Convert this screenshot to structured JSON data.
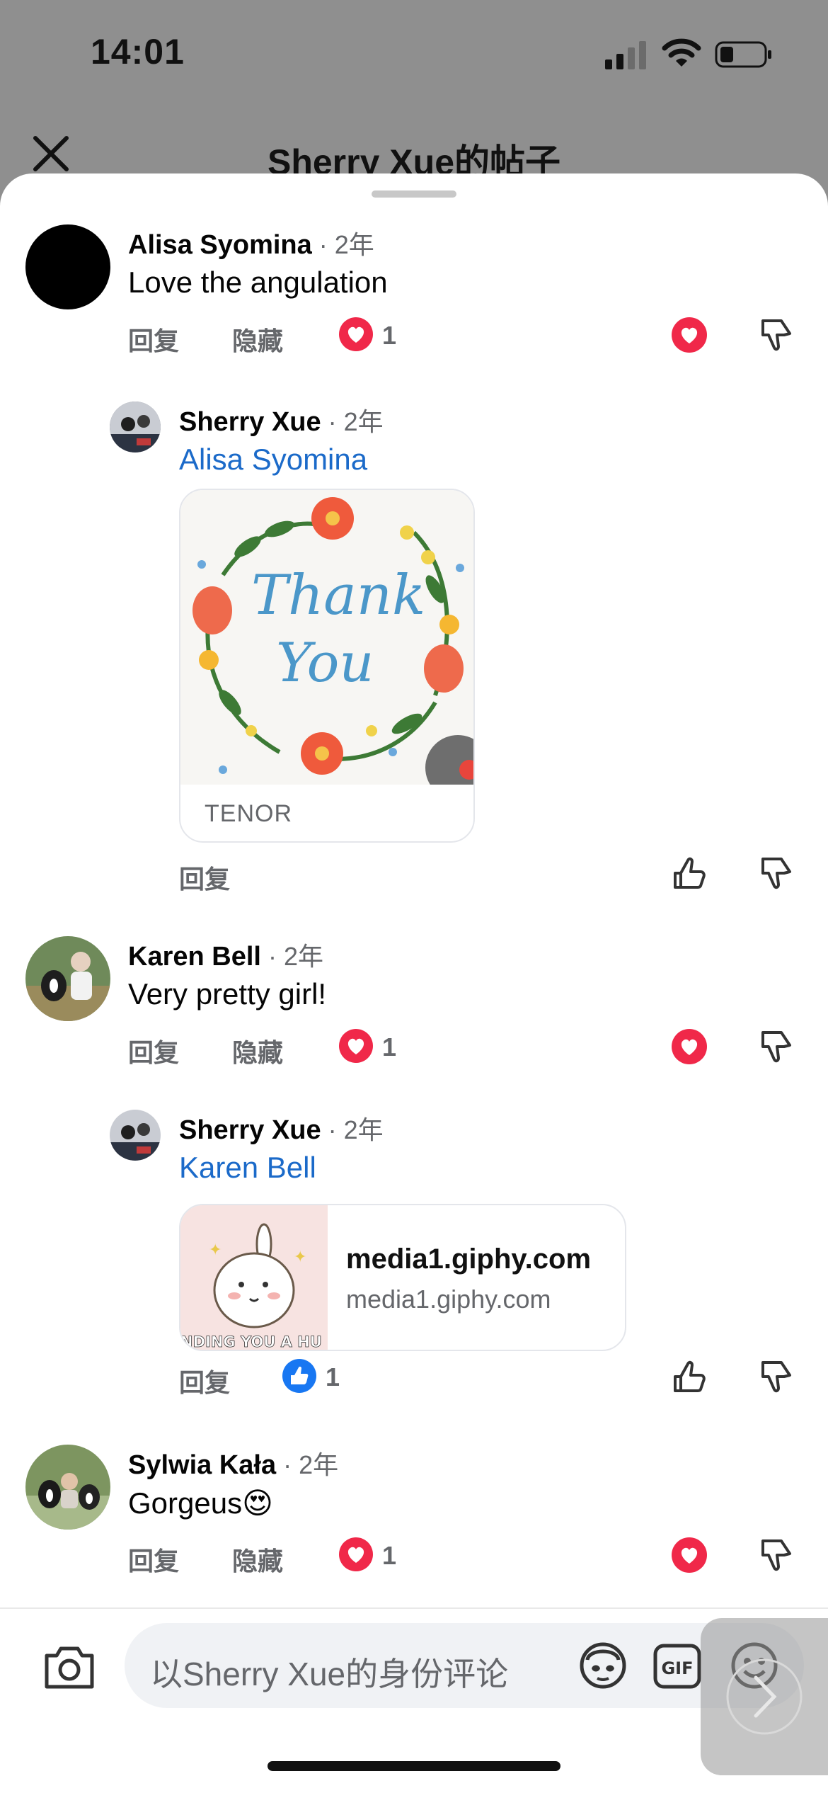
{
  "status_bar": {
    "time": "14:01"
  },
  "header": {
    "title": "Sherry Xue的帖子"
  },
  "actions": {
    "reply": "回复",
    "hide": "隐藏"
  },
  "comments": [
    {
      "author": "Alisa Syomina",
      "dot": "·",
      "time": "2年",
      "text": "Love the angulation",
      "reaction_count": "1",
      "reaction": "heart"
    },
    {
      "author": "Sherry Xue",
      "dot": "·",
      "time": "2年",
      "mention": "Alisa Syomina",
      "attachment": {
        "type": "gif",
        "source": "TENOR",
        "image_text": [
          "Thank",
          "You"
        ]
      }
    },
    {
      "author": "Karen Bell",
      "dot": "·",
      "time": "2年",
      "text": "Very pretty girl!",
      "reaction_count": "1",
      "reaction": "heart"
    },
    {
      "author": "Sherry Xue",
      "dot": "·",
      "time": "2年",
      "mention": "Karen Bell",
      "attachment": {
        "type": "link",
        "title": "media1.giphy.com",
        "subtitle": "media1.giphy.com",
        "thumb_text": "NDING YOU A HU"
      },
      "reaction_count": "1",
      "reaction": "like"
    },
    {
      "author": "Sylwia Kała",
      "dot": "·",
      "time": "2年",
      "text": "Gorgeus😍",
      "reaction_count": "1",
      "reaction": "heart"
    }
  ],
  "composer": {
    "placeholder": "以Sherry Xue的身份评论",
    "gif_label": "GIF"
  },
  "icons": {
    "close": "close-icon",
    "heart": "heart-icon",
    "like": "thumbs-up-icon",
    "dislike": "thumbs-down-icon",
    "camera": "camera-icon",
    "avatar_sticker": "avatar-sticker-icon",
    "gif": "gif-icon",
    "emoji": "emoji-icon"
  },
  "colors": {
    "heart": "#f02849",
    "like": "#1877f2",
    "mention": "#1b6ac9"
  }
}
